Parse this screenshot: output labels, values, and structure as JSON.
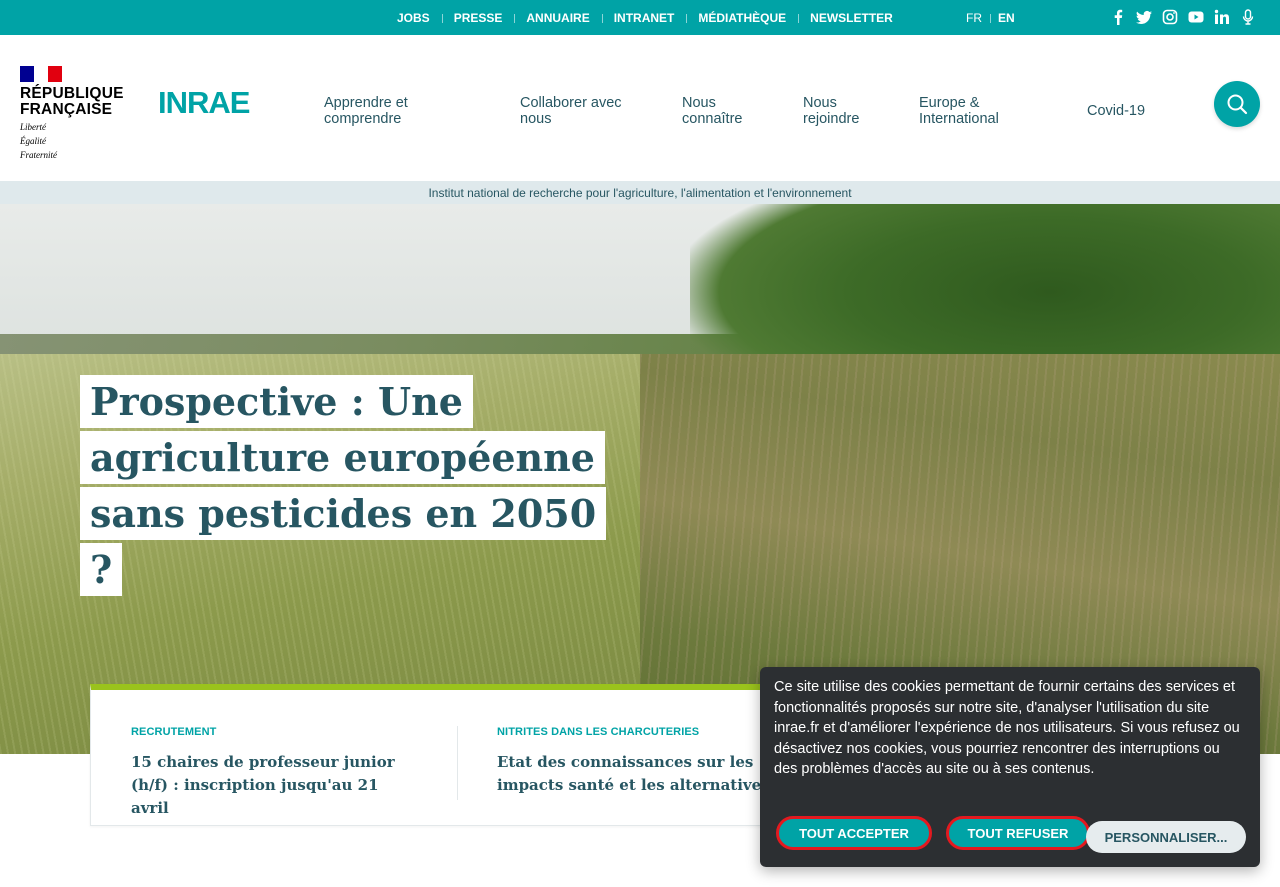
{
  "topbar": {
    "links": [
      "JOBS",
      "PRESSE",
      "ANNUAIRE",
      "INTRANET",
      "MÉDIATHÈQUE",
      "NEWSLETTER"
    ],
    "languages": [
      {
        "label": "FR",
        "active": false
      },
      {
        "label": "EN",
        "active": true
      }
    ],
    "social_icons": [
      "facebook-icon",
      "twitter-icon",
      "instagram-icon",
      "youtube-icon",
      "linkedin-icon",
      "podcast-icon"
    ],
    "background": "#00a3a6"
  },
  "header": {
    "gov_logo": {
      "title_line1": "RÉPUBLIQUE",
      "title_line2": "FRANÇAISE",
      "motto": [
        "Liberté",
        "Égalité",
        "Fraternité"
      ]
    },
    "brand_logo": "INRAE",
    "nav": [
      "Apprendre et comprendre",
      "Collaborer avec nous",
      "Nous connaître",
      "Nous rejoindre",
      "Europe & International",
      "Covid-19"
    ],
    "search_icon": "search-icon",
    "tagline": "Institut national de recherche pour l'agriculture, l'alimentation et l'environnement"
  },
  "hero": {
    "title_lines": [
      "Prospective : Une",
      "agriculture européenne",
      "sans pesticides en 2050 ?"
    ]
  },
  "news": [
    {
      "tag": "RECRUTEMENT",
      "title": "15 chaires de professeur junior (h/f) : inscription jusqu'au 21 avril"
    },
    {
      "tag": "NITRITES DANS LES CHARCUTERIES",
      "title": "Etat des connaissances sur les impacts santé et les alternatives"
    }
  ],
  "cookie_banner": {
    "text": "Ce site utilise des cookies permettant de fournir certains des services et fonctionnalités proposés sur notre site, d'analyser l'utilisation du site inrae.fr et d'améliorer l'expérience de nos utilisateurs. Si vous refusez ou désactivez nos cookies, vous pourriez rencontrer des interruptions ou des problèmes d'accès au site ou à ses contenus.",
    "accept_label": "TOUT ACCEPTER",
    "refuse_label": "TOUT REFUSER",
    "customize_label": "PERSONNALISER..."
  },
  "colors": {
    "accent": "#00a3a6",
    "text": "#275662",
    "highlight": "#9ac31c",
    "alert_outline": "#e3191f"
  }
}
